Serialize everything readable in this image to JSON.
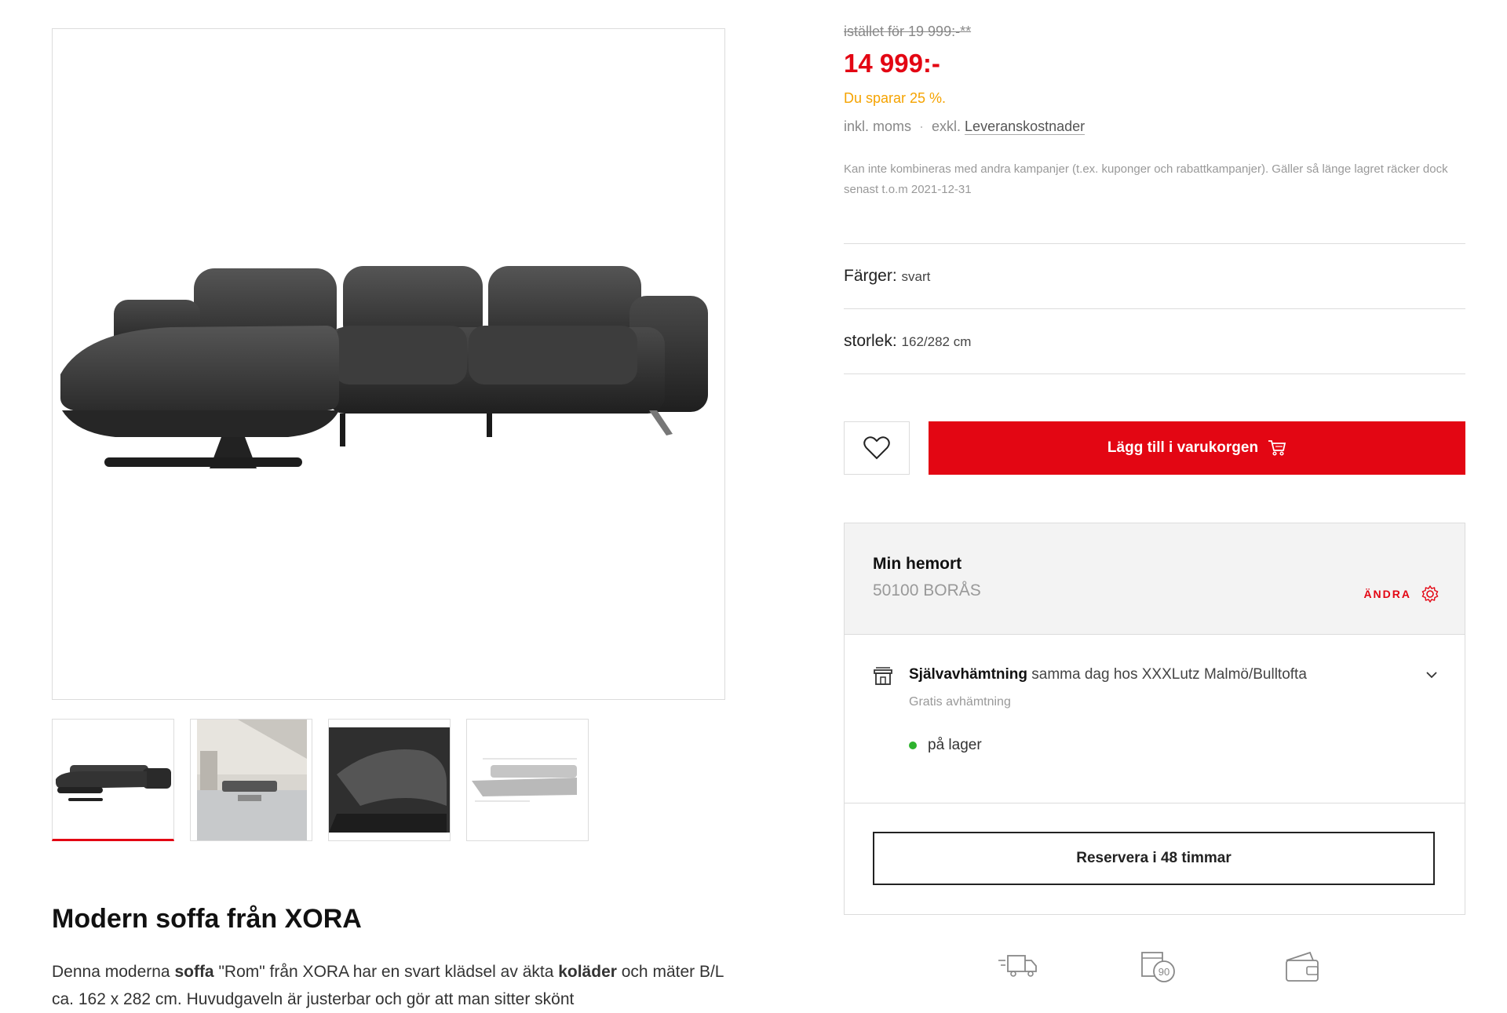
{
  "pricing": {
    "old_price": "istället för 19 999:-**",
    "price": "14 999:-",
    "savings": "Du sparar 25 %.",
    "incl_vat": "inkl. moms",
    "excl": "exkl.",
    "delivery_link": "Leveranskostnader",
    "disclaimer": "Kan inte kombineras med andra kampanjer (t.ex. kuponger och rabattkampanjer). Gäller så länge lagret räcker dock senast t.o.m 2021-12-31"
  },
  "attributes": {
    "colors_label": "Färger:",
    "colors_value": "svart",
    "size_label": "storlek:",
    "size_value": "162/282 cm"
  },
  "actions": {
    "wishlist_icon": "heart-icon",
    "add_to_cart": "Lägg till i varukorgen",
    "cart_icon": "cart-icon"
  },
  "store": {
    "home_label": "Min hemort",
    "home_city": "50100 BORÅS",
    "change_label": "ÄNDRA",
    "change_icon": "gear-icon",
    "pickup_icon": "store-icon",
    "pickup_bold": "Självavhämtning",
    "pickup_rest": "samma dag hos XXXLutz Malmö/Bulltofta",
    "free_pickup": "Gratis avhämtning",
    "stock_status": "på lager",
    "stock_color": "#2db22d",
    "reserve_button": "Reservera i 48 timmar"
  },
  "gallery": {
    "thumbnails": [
      "sofa-product-photo",
      "sofa-living-room-photo",
      "sofa-headrest-detail-photo",
      "sofa-dimension-drawing"
    ],
    "active_index": 0
  },
  "product": {
    "title": "Modern soffa från XORA",
    "desc_1": "Denna moderna ",
    "desc_b1": "soffa",
    "desc_2": " \"Rom\" från XORA har en svart klädsel av äkta ",
    "desc_b2": "koläder",
    "desc_3": " och mäter B/L ca. 162 x 282 cm. Huvudgaveln är justerbar och gör att man sitter skönt"
  },
  "usp_icons": [
    "delivery-truck-icon",
    "return-90-days-icon",
    "wallet-icon"
  ],
  "colors": {
    "accent": "#e30613",
    "savings": "#f5a300",
    "in_stock": "#2db22d"
  }
}
